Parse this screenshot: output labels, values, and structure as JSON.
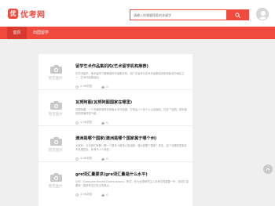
{
  "header": {
    "logo_mark": "优",
    "logo_text": "优考网",
    "search_placeholder": "请输入你想要搜索的关键字",
    "search_icon": "search-icon",
    "avatar_icon": "user-avatar-icon"
  },
  "nav": {
    "items": [
      {
        "label": "首页",
        "active": true
      },
      {
        "label": "出国留学",
        "active": false
      }
    ]
  },
  "articles": [
    {
      "thumb_text": "暂无图片",
      "title": "留学艺术作品集机构(艺术留学机构推荐)",
      "summary": "在艺术留学、美术留学了解海量的作品集机构，而广东省作为艺术作品集培训机构最多的地区之一，艺术作品集培训...",
      "views": "1.0K浏览",
      "likes": "0"
    },
    {
      "thumb_text": "暂无图片",
      "title": "瓦努阿图(瓦努阿图国家在哪里)",
      "summary": "瓦努阿图，一个充满异域风情的南太平洋岛国，它是由八十多个火山岛组成，在这个岛国，常年都是热带海洋性气候...",
      "views": "1.0K浏览",
      "likes": "0"
    },
    {
      "thumb_text": "暂无图片",
      "title": "澳洲是哪个国家(澳洲是哪个国家属于哪个州)",
      "summary": "大家好，今天我们来聊一聊一个很多人都关心的话题：澳洲是哪个国家？其实，这个问题的答案并不是很复杂，却有不少人搞混...",
      "views": "1.0K浏览",
      "likes": "0"
    },
    {
      "thumb_text": "暂无图片",
      "title": "gre词汇量要求(gre词汇量是什么水平)",
      "summary": "GRE（Graduate Record Examinations）考试，作为全球研究生入学考试的重要一环，其词汇量要求一直是考生们关注的焦点...",
      "views": "1.0K浏览",
      "likes": "0"
    }
  ],
  "colors": {
    "brand": "#f0493e",
    "nav_active": "#d83a30"
  }
}
